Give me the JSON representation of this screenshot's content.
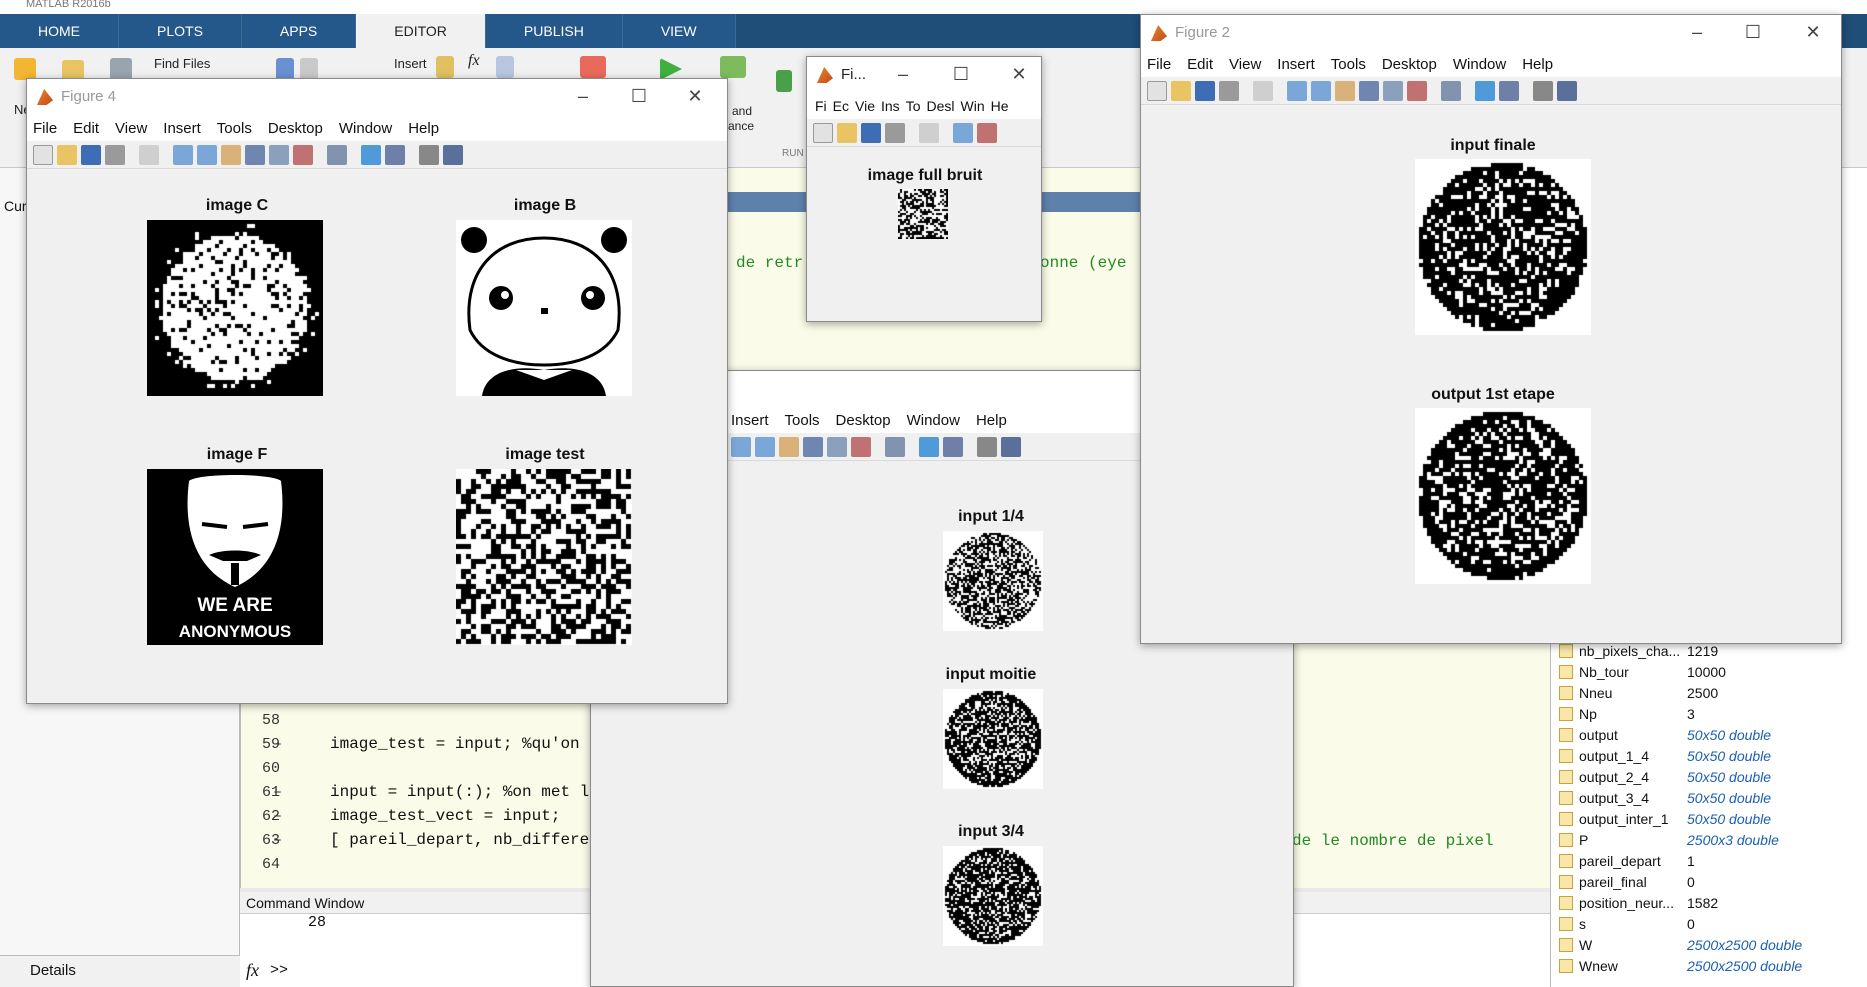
{
  "app": {
    "title": "MATLAB R2016b"
  },
  "ribbon": {
    "tabs": [
      "HOME",
      "PLOTS",
      "APPS",
      "EDITOR",
      "PUBLISH",
      "VIEW"
    ],
    "find_files": "Find Files",
    "insert": "Insert",
    "fx": "fx",
    "run_label": "RUN",
    "run_and_advance": "n and\nvance",
    "new_label": "Ne"
  },
  "editor": {
    "comment_fragment": "de retr",
    "comment_fragment2": "onne (eye",
    "lines": [
      {
        "num": "58",
        "dash": "",
        "code": ""
      },
      {
        "num": "59",
        "dash": "–",
        "code": "image_test = input; %qu'on"
      },
      {
        "num": "60",
        "dash": "",
        "code": ""
      },
      {
        "num": "61",
        "dash": "–",
        "code": "input = input(:); %on met l"
      },
      {
        "num": "62",
        "dash": "–",
        "code": "image_test_vect = input;"
      },
      {
        "num": "63",
        "dash": "–",
        "code": "[ pareil_depart, nb_differe"
      },
      {
        "num": "64",
        "dash": "",
        "code": ""
      }
    ],
    "trailing_comment": "de le nombre de pixel"
  },
  "left_panel": {
    "label": "Cur",
    "details": "Details"
  },
  "command_window": {
    "title": "Command Window",
    "output": "28",
    "prompt": ">>",
    "fx": "fx"
  },
  "workspace": {
    "rows": [
      {
        "name": "nb_pixels_cha...",
        "value": "1219",
        "italic": false
      },
      {
        "name": "Nb_tour",
        "value": "10000",
        "italic": false
      },
      {
        "name": "Nneu",
        "value": "2500",
        "italic": false
      },
      {
        "name": "Np",
        "value": "3",
        "italic": false
      },
      {
        "name": "output",
        "value": "50x50 double",
        "italic": true
      },
      {
        "name": "output_1_4",
        "value": "50x50 double",
        "italic": true
      },
      {
        "name": "output_2_4",
        "value": "50x50 double",
        "italic": true
      },
      {
        "name": "output_3_4",
        "value": "50x50 double",
        "italic": true
      },
      {
        "name": "output_inter_1",
        "value": "50x50 double",
        "italic": true
      },
      {
        "name": "P",
        "value": "2500x3 double",
        "italic": true
      },
      {
        "name": "pareil_depart",
        "value": "1",
        "italic": false
      },
      {
        "name": "pareil_final",
        "value": "0",
        "italic": false
      },
      {
        "name": "position_neur...",
        "value": "1582",
        "italic": false
      },
      {
        "name": "s",
        "value": "0",
        "italic": false
      },
      {
        "name": "W",
        "value": "2500x2500 double",
        "italic": true
      },
      {
        "name": "Wnew",
        "value": "2500x2500 double",
        "italic": true
      }
    ]
  },
  "figure4": {
    "title": "Figure 4",
    "menu": [
      "File",
      "Edit",
      "View",
      "Insert",
      "Tools",
      "Desktop",
      "Window",
      "Help"
    ],
    "plots": [
      "image C",
      "image B",
      "image F",
      "image test"
    ],
    "poster_text_1": "WE ARE",
    "poster_text_2": "ANONYMOUS"
  },
  "figure_small": {
    "title": "Fi...",
    "menu": [
      "Fi",
      "Ec",
      "Vie",
      "Ins",
      "To",
      "Desl",
      "Win",
      "He"
    ],
    "plot": "image full bruit"
  },
  "figure2": {
    "title": "Figure 2",
    "menu": [
      "File",
      "Edit",
      "View",
      "Insert",
      "Tools",
      "Desktop",
      "Window",
      "Help"
    ],
    "plots": [
      "input finale",
      "output 1st etape"
    ]
  },
  "figure_mid": {
    "menu": [
      "Insert",
      "Tools",
      "Desktop",
      "Window",
      "Help"
    ],
    "plots": [
      "input 1/4",
      "input moitie",
      "input 3/4"
    ]
  },
  "colors": {
    "ribbon_blue": "#1f4e79",
    "comment_green": "#228b22",
    "var_blue": "#1a5fb4"
  }
}
